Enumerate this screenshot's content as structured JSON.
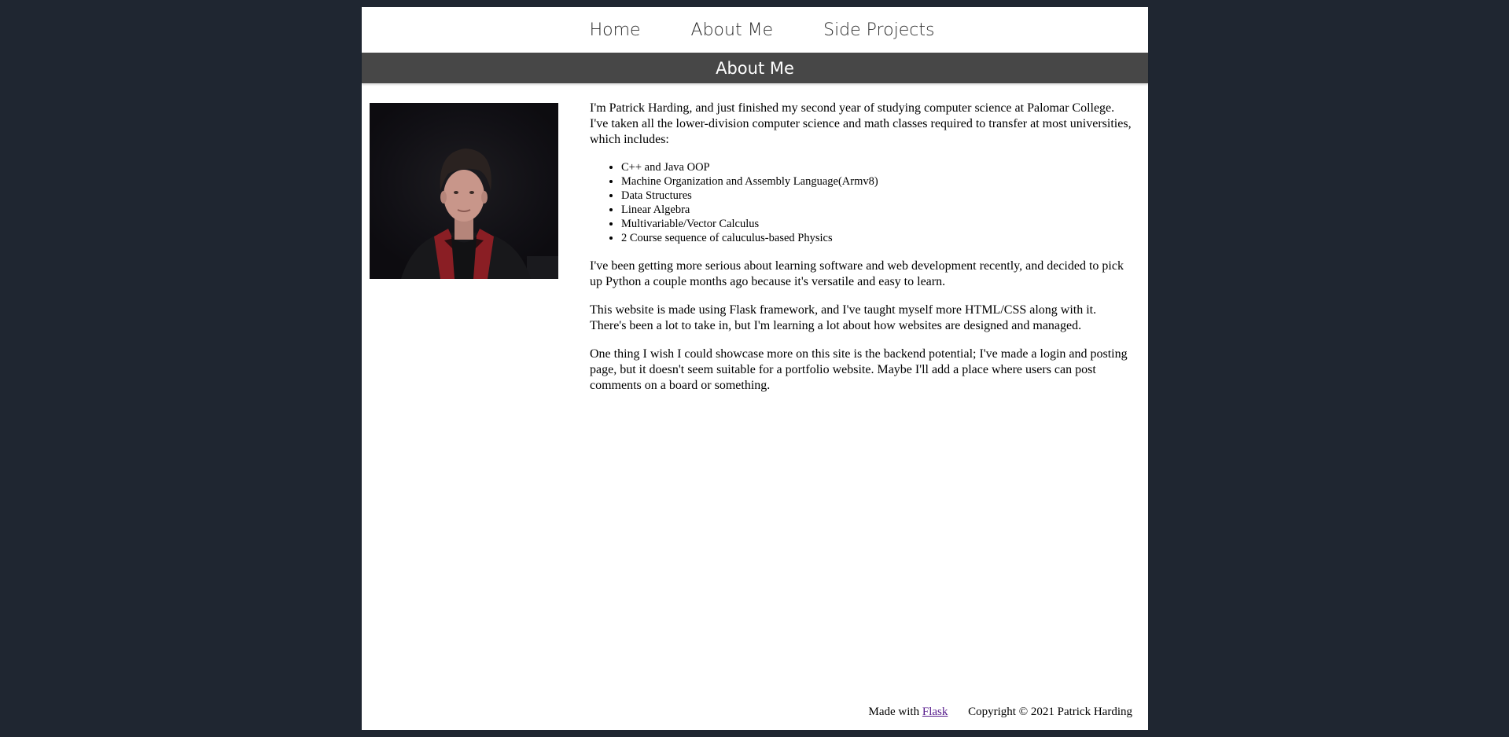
{
  "nav": {
    "items": [
      {
        "label": "Home"
      },
      {
        "label": "About Me"
      },
      {
        "label": "Side Projects"
      }
    ]
  },
  "header": {
    "title": "About Me"
  },
  "main": {
    "intro": "I'm Patrick Harding, and just finished my second year of studying computer science at Palomar College. I've taken all the lower-division computer science and math classes required to transfer at most universities, which includes:",
    "courses": [
      "C++ and Java OOP",
      "Machine Organization and Assembly Language(Armv8)",
      "Data Structures",
      "Linear Algebra",
      "Multivariable/Vector Calculus",
      "2 Course sequence of caluculus-based Physics"
    ],
    "paragraph_2": "I've been getting more serious about learning software and web development recently, and decided to pick up Python a couple months ago because it's versatile and easy to learn.",
    "paragraph_3": "This website is made using Flask framework, and I've taught myself more HTML/CSS along with it. There's been a lot to take in, but I'm learning a lot about how websites are designed and managed.",
    "paragraph_4": "One thing I wish I could showcase more on this site is the backend potential; I've made a login and posting page, but it doesn't seem suitable for a portfolio website. Maybe I'll add a place where users can post comments on a board or something."
  },
  "footer": {
    "made_with": "Made with",
    "flask_link": "Flask",
    "copyright": "Copyright © 2021 Patrick Harding"
  },
  "colors": {
    "background": "#1f2631",
    "title_bar": "#474747",
    "link_visited": "#551a8b"
  }
}
